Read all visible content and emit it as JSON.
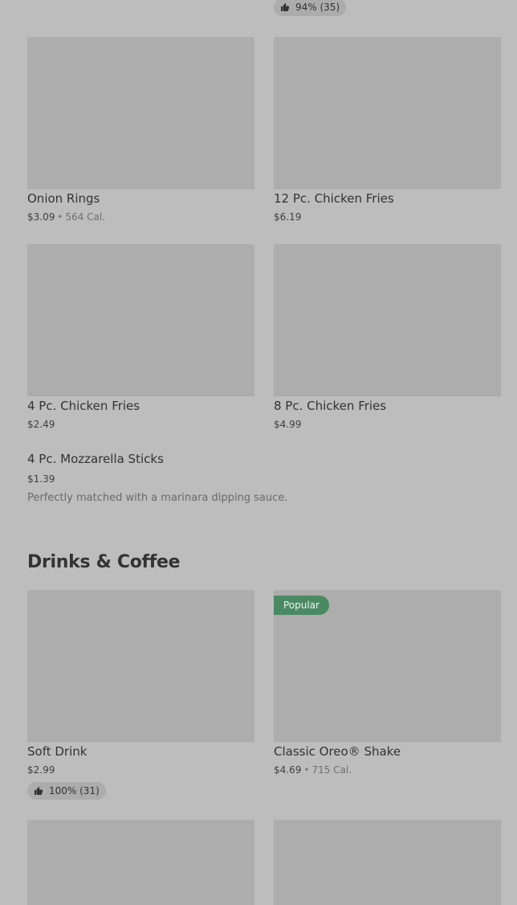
{
  "top_rating": {
    "label": "94% (35)"
  },
  "side_items": [
    {
      "name": "Onion Rings",
      "price": "$3.09",
      "calories": "564 Cal."
    },
    {
      "name": "12 Pc. Chicken Fries",
      "price": "$6.19"
    },
    {
      "name": "4 Pc. Chicken Fries",
      "price": "$2.49"
    },
    {
      "name": "8 Pc. Chicken Fries",
      "price": "$4.99"
    }
  ],
  "text_item": {
    "name": "4 Pc. Mozzarella Sticks",
    "price": "$1.39",
    "description": "Perfectly matched with a marinara dipping sauce."
  },
  "drinks_section": {
    "title": "Drinks & Coffee",
    "items": [
      {
        "name": "Soft Drink",
        "price": "$2.99",
        "rating": "100% (31)"
      },
      {
        "name": "Classic Oreo® Shake",
        "price": "$4.69",
        "calories": "715 Cal.",
        "badge": "Popular"
      }
    ]
  },
  "separator": "•",
  "icons": {
    "rating": "thumbs-up-icon"
  },
  "colors": {
    "background": "#bdbdbd",
    "image_placeholder": "#adadad",
    "popular_badge": "#4a8a63"
  }
}
